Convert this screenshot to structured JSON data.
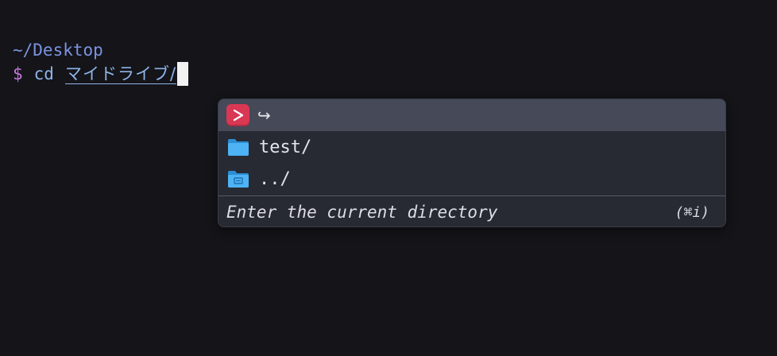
{
  "terminal": {
    "cwd": "~/Desktop",
    "prompt_symbol": "$",
    "command": "cd",
    "argument": "マイドライブ/"
  },
  "autocomplete": {
    "header": {
      "app_icon": "fig-prompt-icon",
      "return_icon": "↪"
    },
    "items": [
      {
        "label": "test/",
        "icon": "folder-icon"
      },
      {
        "label": "../",
        "icon": "parent-folder-icon"
      }
    ],
    "description": "Enter the current directory",
    "shortcut": "(⌘i)"
  },
  "colors": {
    "background": "#141419",
    "cwd": "#7b93e0",
    "prompt": "#c678dd",
    "command": "#8fb4e8",
    "popup_bg": "#272a33",
    "popup_header": "#454958",
    "app_icon": "#d93753",
    "folder": "#3fa9f0"
  }
}
